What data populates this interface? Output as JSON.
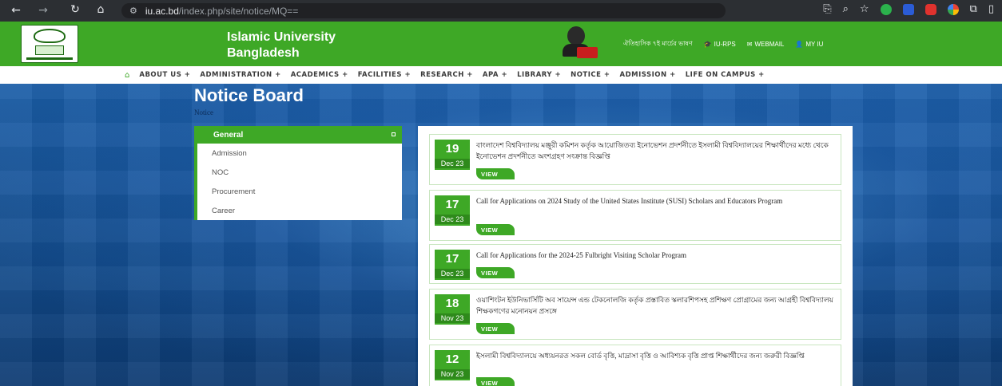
{
  "browser": {
    "url_host": "iu.ac.bd",
    "url_path": "/index.php/site/notice/MQ=="
  },
  "site": {
    "name": "Islamic University Bangladesh",
    "header_links": {
      "bangla_campaign": "ঐতিহাসিক ৭ই মার্চের ভাষণ",
      "iu_rps": "IU-RPS",
      "webmail": "WEBMAIL",
      "my_iu": "MY IU"
    }
  },
  "nav": {
    "items": [
      "ABOUT US +",
      "ADMINISTRATION +",
      "ACADEMICS +",
      "FACILITIES +",
      "RESEARCH +",
      "APA +",
      "LIBRARY +",
      "NOTICE +",
      "ADMISSION +",
      "LIFE ON CAMPUS +"
    ]
  },
  "page": {
    "title": "Notice Board",
    "breadcrumb": "Notice"
  },
  "sidebar": {
    "heading": "General",
    "items": [
      "Admission",
      "NOC",
      "Procurement",
      "Career"
    ]
  },
  "notices": [
    {
      "day": "19",
      "month": "Dec 23",
      "title": "বাংলাদেশ বিশ্ববিদ্যালয় মঞ্জুরী কমিশন কর্তৃক আয়োজিতব্য ইনোভেশন প্রদর্শনীতে ইসলামী বিশ্ববিদ্যালয়ের শিক্ষার্থীদের মধ্যে থেকে ইনোভেশন প্রদর্শনীতে অংশগ্রহণ সংক্রান্ত বিজ্ঞপ্তি",
      "view": "VIEW"
    },
    {
      "day": "17",
      "month": "Dec 23",
      "title": "Call for Applications on 2024 Study of the United States Institute (SUSI) Scholars and Educators Program",
      "view": "VIEW"
    },
    {
      "day": "17",
      "month": "Dec 23",
      "title": "Call for Applications for the 2024-25 Fulbright Visiting Scholar Program",
      "view": "VIEW"
    },
    {
      "day": "18",
      "month": "Nov 23",
      "title": "ওয়াশিংটন ইউনিভার্সিটি অব সায়েন্স এন্ড টেকনোলজি কর্তৃক প্রস্তাবিত স্কলারশিপসহ প্রশিক্ষণ প্রোগ্রামের জন্য আগ্রহী বিশ্ববিদ্যালয় শিক্ষকগণের মনোনয়ন প্রসঙ্গে",
      "view": "VIEW"
    },
    {
      "day": "12",
      "month": "Nov 23",
      "title": "ইসলামী বিশ্ববিদ্যালয়ে অধ্যয়নরত সকল বোর্ড বৃত্তি, মাদ্রাসা বৃত্তি ও আবিশ্যক বৃত্তি প্রাপ্ত শিক্ষার্থীদের জন্য জরুরী বিজ্ঞপ্তি",
      "view": "VIEW"
    }
  ]
}
